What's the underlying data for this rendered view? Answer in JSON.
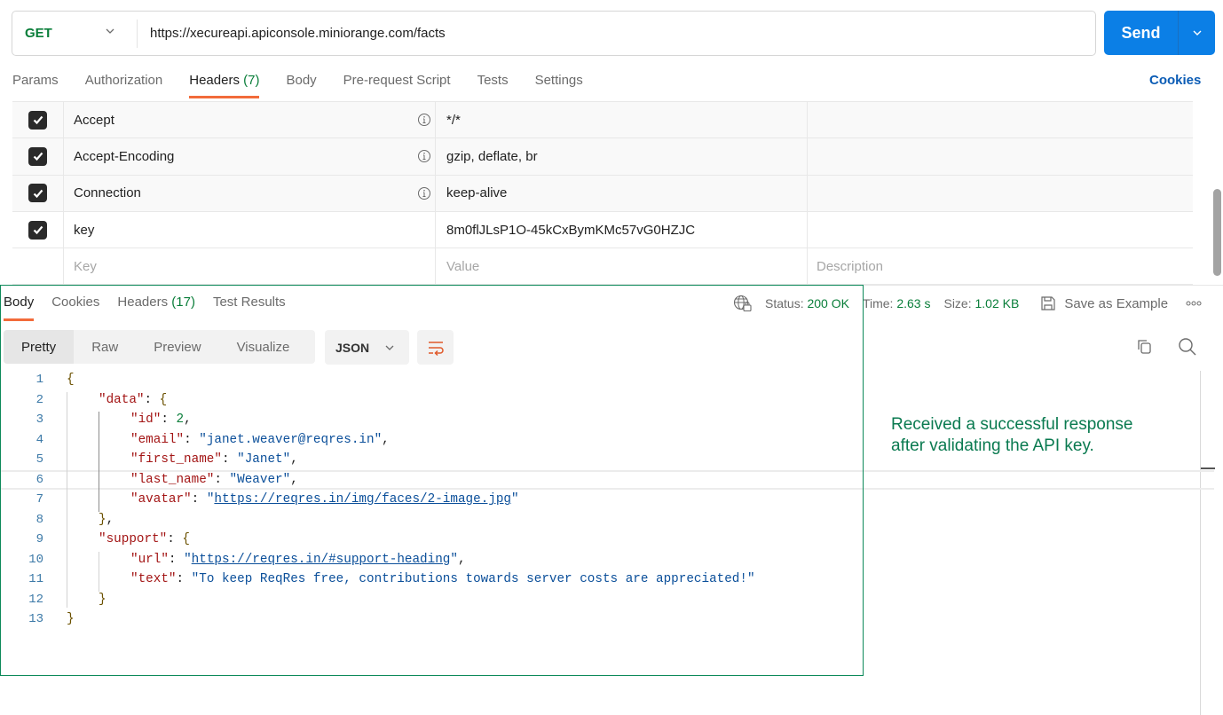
{
  "request": {
    "method": "GET",
    "url": "https://xecureapi.apiconsole.miniorange.com/facts",
    "send_label": "Send",
    "tabs": [
      {
        "label": "Params",
        "count": ""
      },
      {
        "label": "Authorization",
        "count": ""
      },
      {
        "label": "Headers",
        "count": "(7)"
      },
      {
        "label": "Body",
        "count": ""
      },
      {
        "label": "Pre-request Script",
        "count": ""
      },
      {
        "label": "Tests",
        "count": ""
      },
      {
        "label": "Settings",
        "count": ""
      }
    ],
    "active_tab": "Headers",
    "cookies_label": "Cookies"
  },
  "headers_table": {
    "rows": [
      {
        "checked": true,
        "key": "Accept",
        "value": "*/*",
        "description": "",
        "auto": true
      },
      {
        "checked": true,
        "key": "Accept-Encoding",
        "value": "gzip, deflate, br",
        "description": "",
        "auto": true
      },
      {
        "checked": true,
        "key": "Connection",
        "value": "keep-alive",
        "description": "",
        "auto": true
      },
      {
        "checked": true,
        "key": "key",
        "value": "8m0flJLsP1O-45kCxBymKMc57vG0HZJC",
        "description": "",
        "auto": false
      }
    ],
    "placeholders": {
      "key": "Key",
      "value": "Value",
      "description": "Description"
    }
  },
  "response": {
    "tabs": [
      {
        "label": "Body",
        "count": ""
      },
      {
        "label": "Cookies",
        "count": ""
      },
      {
        "label": "Headers",
        "count": "(17)"
      },
      {
        "label": "Test Results",
        "count": ""
      }
    ],
    "active_tab": "Body",
    "status_label": "Status:",
    "status_value": "200 OK",
    "time_label": "Time:",
    "time_value": "2.63 s",
    "size_label": "Size:",
    "size_value": "1.02 KB",
    "save_example_label": "Save as Example",
    "view_modes": [
      "Pretty",
      "Raw",
      "Preview",
      "Visualize"
    ],
    "active_view": "Pretty",
    "format": "JSON",
    "code_lines": [
      {
        "n": "1",
        "indent": 0,
        "parts": [
          [
            "br",
            "{"
          ]
        ]
      },
      {
        "n": "2",
        "indent": 1,
        "parts": [
          [
            "k",
            "\"data\""
          ],
          [
            "p",
            ": "
          ],
          [
            "br",
            "{"
          ]
        ]
      },
      {
        "n": "3",
        "indent": 2,
        "parts": [
          [
            "k",
            "\"id\""
          ],
          [
            "p",
            ": "
          ],
          [
            "n",
            "2"
          ],
          [
            "p",
            ","
          ]
        ]
      },
      {
        "n": "4",
        "indent": 2,
        "parts": [
          [
            "k",
            "\"email\""
          ],
          [
            "p",
            ": "
          ],
          [
            "s",
            "\"janet.weaver@reqres.in\""
          ],
          [
            "p",
            ","
          ]
        ]
      },
      {
        "n": "5",
        "indent": 2,
        "parts": [
          [
            "k",
            "\"first_name\""
          ],
          [
            "p",
            ": "
          ],
          [
            "s",
            "\"Janet\""
          ],
          [
            "p",
            ","
          ]
        ]
      },
      {
        "n": "6",
        "indent": 2,
        "parts": [
          [
            "k",
            "\"last_name\""
          ],
          [
            "p",
            ": "
          ],
          [
            "s",
            "\"Weaver\""
          ],
          [
            "p",
            ","
          ]
        ]
      },
      {
        "n": "7",
        "indent": 2,
        "parts": [
          [
            "k",
            "\"avatar\""
          ],
          [
            "p",
            ": "
          ],
          [
            "s",
            "\""
          ],
          [
            "u",
            "https://reqres.in/img/faces/2-image.jpg"
          ],
          [
            "s",
            "\""
          ]
        ]
      },
      {
        "n": "8",
        "indent": 1,
        "parts": [
          [
            "br",
            "}"
          ],
          [
            "p",
            ","
          ]
        ]
      },
      {
        "n": "9",
        "indent": 1,
        "parts": [
          [
            "k",
            "\"support\""
          ],
          [
            "p",
            ": "
          ],
          [
            "br",
            "{"
          ]
        ]
      },
      {
        "n": "10",
        "indent": 2,
        "parts": [
          [
            "k",
            "\"url\""
          ],
          [
            "p",
            ": "
          ],
          [
            "s",
            "\""
          ],
          [
            "u",
            "https://reqres.in/#support-heading"
          ],
          [
            "s",
            "\""
          ],
          [
            "p",
            ","
          ]
        ]
      },
      {
        "n": "11",
        "indent": 2,
        "parts": [
          [
            "k",
            "\"text\""
          ],
          [
            "p",
            ": "
          ],
          [
            "s",
            "\"To keep ReqRes free, contributions towards server costs are appreciated!\""
          ]
        ]
      },
      {
        "n": "12",
        "indent": 1,
        "parts": [
          [
            "br",
            "}"
          ]
        ]
      },
      {
        "n": "13",
        "indent": 0,
        "parts": [
          [
            "br",
            "}"
          ]
        ]
      }
    ],
    "highlighted_line": "6"
  },
  "annotation": "Received a successful response after validating the API key.",
  "colors": {
    "accent_send": "#0b7fe6",
    "active_tab_underline": "#f26b3a",
    "status_green": "#0a7e3a",
    "annotation_green": "#0a7a50",
    "outline_green": "#0d8a5a"
  }
}
